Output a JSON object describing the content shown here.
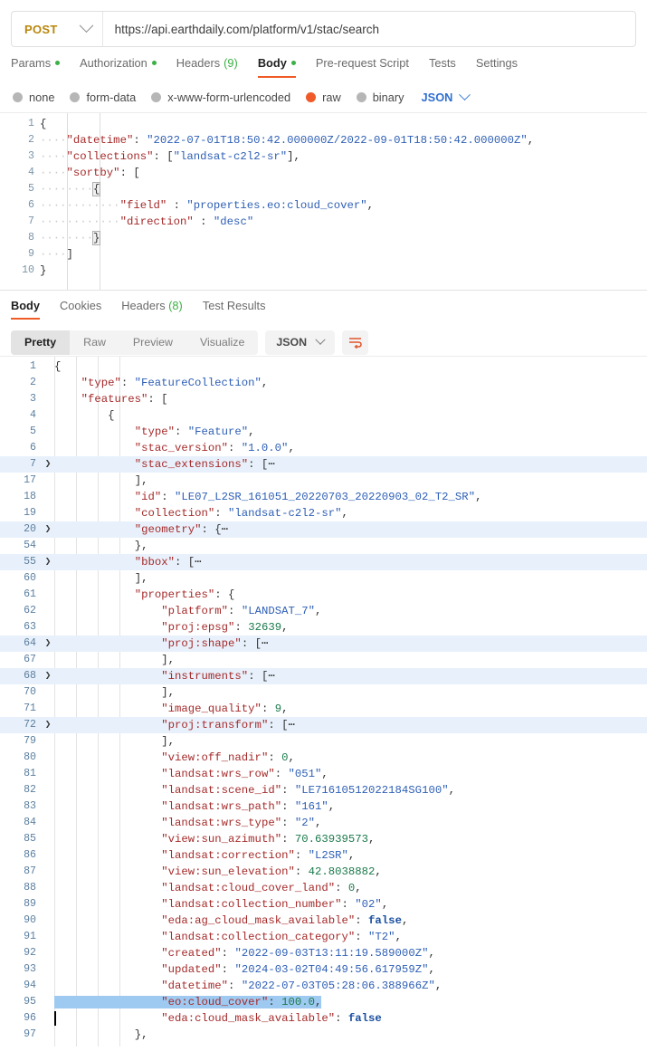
{
  "request": {
    "method": "POST",
    "method_dropdown_icon": "chevron-down-icon",
    "url": "https://api.earthdaily.com/platform/v1/stac/search",
    "tabs": [
      {
        "label": "Params",
        "dot": true,
        "active": false
      },
      {
        "label": "Authorization",
        "dot": true,
        "active": false
      },
      {
        "label": "Headers",
        "count": "(9)",
        "active": false
      },
      {
        "label": "Body",
        "dot": true,
        "active": true
      },
      {
        "label": "Pre-request Script",
        "active": false
      },
      {
        "label": "Tests",
        "active": false
      },
      {
        "label": "Settings",
        "active": false
      }
    ],
    "body_types": [
      {
        "label": "none",
        "selected": false
      },
      {
        "label": "form-data",
        "selected": false
      },
      {
        "label": "x-www-form-urlencoded",
        "selected": false
      },
      {
        "label": "raw",
        "selected": true
      },
      {
        "label": "binary",
        "selected": false
      }
    ],
    "body_format": "JSON",
    "body_lines": [
      {
        "num": "1",
        "indent": 0,
        "code": "{"
      },
      {
        "num": "2",
        "indent": 1,
        "code": "\"datetime\": \"2022-07-01T18:50:42.000000Z/2022-09-01T18:50:42.000000Z\","
      },
      {
        "num": "3",
        "indent": 1,
        "code": "\"collections\": [\"landsat-c2l2-sr\"],"
      },
      {
        "num": "4",
        "indent": 1,
        "code": "\"sortby\": ["
      },
      {
        "num": "5",
        "indent": 2,
        "code": "{"
      },
      {
        "num": "6",
        "indent": 3,
        "code": "\"field\" : \"properties.eo:cloud_cover\","
      },
      {
        "num": "7",
        "indent": 3,
        "code": "\"direction\" : \"desc\""
      },
      {
        "num": "8",
        "indent": 2,
        "code": "}"
      },
      {
        "num": "9",
        "indent": 1,
        "code": "]"
      },
      {
        "num": "10",
        "indent": 0,
        "code": "}"
      }
    ]
  },
  "response": {
    "tabs": [
      {
        "label": "Body",
        "active": true
      },
      {
        "label": "Cookies",
        "active": false
      },
      {
        "label": "Headers",
        "count": "(8)",
        "active": false
      },
      {
        "label": "Test Results",
        "active": false
      }
    ],
    "format_tabs": [
      {
        "label": "Pretty",
        "active": true
      },
      {
        "label": "Raw",
        "active": false
      },
      {
        "label": "Preview",
        "active": false
      },
      {
        "label": "Visualize",
        "active": false
      }
    ],
    "format_type": "JSON",
    "wrap_icon": "wrap-lines-icon",
    "body_lines": [
      {
        "num": "1",
        "code": "{"
      },
      {
        "num": "2",
        "code": "    \"type\": \"FeatureCollection\","
      },
      {
        "num": "3",
        "code": "    \"features\": ["
      },
      {
        "num": "4",
        "code": "        {"
      },
      {
        "num": "5",
        "code": "            \"type\": \"Feature\","
      },
      {
        "num": "6",
        "code": "            \"stac_version\": \"1.0.0\","
      },
      {
        "num": "7",
        "code": "            \"stac_extensions\": [⋯",
        "folded": true
      },
      {
        "num": "17",
        "code": "            ],"
      },
      {
        "num": "18",
        "code": "            \"id\": \"LE07_L2SR_161051_20220703_20220903_02_T2_SR\","
      },
      {
        "num": "19",
        "code": "            \"collection\": \"landsat-c2l2-sr\","
      },
      {
        "num": "20",
        "code": "            \"geometry\": {⋯",
        "folded": true
      },
      {
        "num": "54",
        "code": "            },"
      },
      {
        "num": "55",
        "code": "            \"bbox\": [⋯",
        "folded": true
      },
      {
        "num": "60",
        "code": "            ],"
      },
      {
        "num": "61",
        "code": "            \"properties\": {"
      },
      {
        "num": "62",
        "code": "                \"platform\": \"LANDSAT_7\","
      },
      {
        "num": "63",
        "code": "                \"proj:epsg\": 32639,"
      },
      {
        "num": "64",
        "code": "                \"proj:shape\": [⋯",
        "folded": true
      },
      {
        "num": "67",
        "code": "                ],"
      },
      {
        "num": "68",
        "code": "                \"instruments\": [⋯",
        "folded": true
      },
      {
        "num": "70",
        "code": "                ],"
      },
      {
        "num": "71",
        "code": "                \"image_quality\": 9,"
      },
      {
        "num": "72",
        "code": "                \"proj:transform\": [⋯",
        "folded": true
      },
      {
        "num": "79",
        "code": "                ],"
      },
      {
        "num": "80",
        "code": "                \"view:off_nadir\": 0,"
      },
      {
        "num": "81",
        "code": "                \"landsat:wrs_row\": \"051\","
      },
      {
        "num": "82",
        "code": "                \"landsat:scene_id\": \"LE71610512022184SG100\","
      },
      {
        "num": "83",
        "code": "                \"landsat:wrs_path\": \"161\","
      },
      {
        "num": "84",
        "code": "                \"landsat:wrs_type\": \"2\","
      },
      {
        "num": "85",
        "code": "                \"view:sun_azimuth\": 70.63939573,"
      },
      {
        "num": "86",
        "code": "                \"landsat:correction\": \"L2SR\","
      },
      {
        "num": "87",
        "code": "                \"view:sun_elevation\": 42.8038882,"
      },
      {
        "num": "88",
        "code": "                \"landsat:cloud_cover_land\": 0,"
      },
      {
        "num": "89",
        "code": "                \"landsat:collection_number\": \"02\","
      },
      {
        "num": "90",
        "code": "                \"eda:ag_cloud_mask_available\": false,"
      },
      {
        "num": "91",
        "code": "                \"landsat:collection_category\": \"T2\","
      },
      {
        "num": "92",
        "code": "                \"created\": \"2022-09-03T13:11:19.589000Z\","
      },
      {
        "num": "93",
        "code": "                \"updated\": \"2024-03-02T04:49:56.617959Z\","
      },
      {
        "num": "94",
        "code": "                \"datetime\": \"2022-07-03T05:28:06.388966Z\","
      },
      {
        "num": "95",
        "code": "                \"eo:cloud_cover\": 100.0,",
        "selected": true
      },
      {
        "num": "96",
        "code": "                \"eda:cloud_mask_available\": false",
        "caret": true
      },
      {
        "num": "97",
        "code": "            },"
      }
    ]
  },
  "colors": {
    "accent": "#ef5b25",
    "method": "#b8860b",
    "dot_green": "#3bb143",
    "key": "#a52a2a",
    "string": "#2e5fb5",
    "number": "#1a7a4c",
    "boolean": "#1a4fa0",
    "fold_highlight": "#e8f1fb",
    "selection": "#9ec9f0"
  }
}
